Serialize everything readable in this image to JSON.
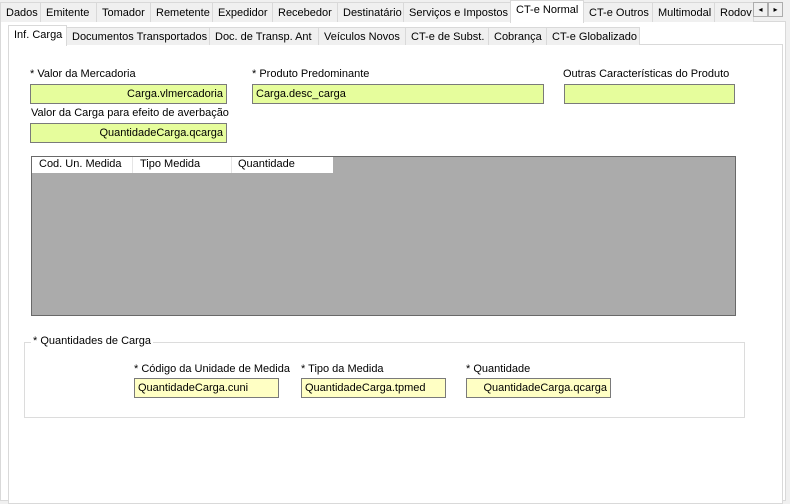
{
  "outer_tabs": [
    "Dados",
    "Emitente",
    "Tomador",
    "Remetente",
    "Expedidor",
    "Recebedor",
    "Destinatário",
    "Serviços e Impostos",
    "CT-e Normal",
    "CT-e Outros",
    "Multimodal",
    "Rodov"
  ],
  "outer_selected": "CT-e Normal",
  "inner_tabs": [
    "Inf. Carga",
    "Documentos Transportados",
    "Doc. de Transp. Ant",
    "Veículos Novos",
    "CT-e de Subst.",
    "Cobrança",
    "CT-e Globalizado"
  ],
  "inner_selected": "Inf. Carga",
  "scroll": {
    "left": "◂",
    "right": "▸"
  },
  "form": {
    "valor_mercadoria": {
      "label": "* Valor da Mercadoria",
      "value": "Carga.vlmercadoria"
    },
    "produto": {
      "label": "* Produto Predominante",
      "value": "Carga.desc_carga"
    },
    "outras": {
      "label": "Outras Características do Produto",
      "value": ""
    },
    "valor_averbacao": {
      "label": "Valor da Carga para efeito de averbação",
      "value": "QuantidadeCarga.qcarga"
    }
  },
  "grid": {
    "columns": [
      "Cod. Un. Medida",
      "Tipo Medida",
      "Quantidade"
    ]
  },
  "group": {
    "title": "* Quantidades de Carga",
    "cuni": {
      "label": "* Código da Unidade de Medida",
      "value": "QuantidadeCarga.cuni"
    },
    "tpmed": {
      "label": "* Tipo da Medida",
      "value": "QuantidadeCarga.tpmed"
    },
    "qcarga": {
      "label": "* Quantidade",
      "value": "QuantidadeCarga.qcarga"
    }
  },
  "colors": {
    "required_field": "#e6fd9c",
    "group_field": "#ffffc4",
    "grid_bg": "#ababab"
  }
}
